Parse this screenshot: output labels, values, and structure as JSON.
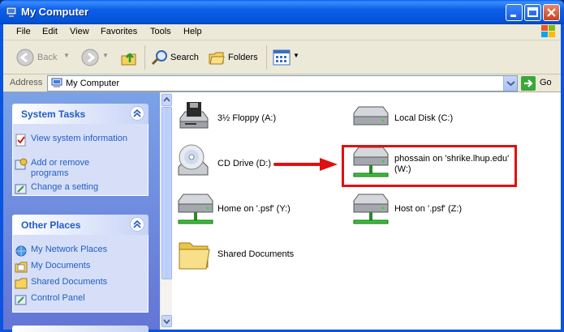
{
  "window": {
    "title": "My Computer"
  },
  "menu": [
    "File",
    "Edit",
    "View",
    "Favorites",
    "Tools",
    "Help"
  ],
  "toolbar": {
    "back": "Back",
    "search": "Search",
    "folders": "Folders"
  },
  "address": {
    "label": "Address",
    "value": "My Computer",
    "go": "Go"
  },
  "system_tasks": {
    "title": "System Tasks",
    "items": [
      "View system information",
      "Add or remove programs",
      "Change a setting"
    ]
  },
  "other_places": {
    "title": "Other Places",
    "items": [
      "My Network Places",
      "My Documents",
      "Shared Documents",
      "Control Panel"
    ]
  },
  "drives": [
    {
      "label": "3½ Floppy (A:)",
      "icon": "floppy-drive-icon"
    },
    {
      "label": "Local Disk (C:)",
      "icon": "hard-disk-icon"
    },
    {
      "label": "CD Drive (D:)",
      "icon": "cd-drive-icon"
    },
    {
      "label": "phossain on 'shrike.lhup.edu'",
      "label2": "(W:)",
      "icon": "network-drive-icon"
    },
    {
      "label": "Home on '.psf' (Y:)",
      "icon": "network-drive-icon"
    },
    {
      "label": "Host on '.psf' (Z:)",
      "icon": "network-drive-icon"
    },
    {
      "label": "Shared Documents",
      "icon": "folder-icon"
    }
  ],
  "colors": {
    "highlight": "#e01010",
    "link": "#215dc6"
  }
}
